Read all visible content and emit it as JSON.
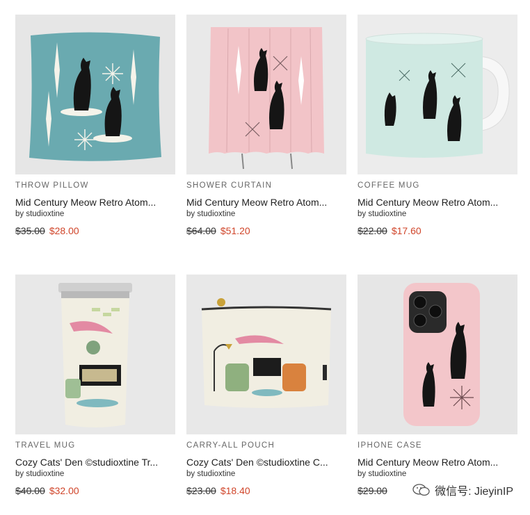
{
  "products": [
    {
      "category": "THROW PILLOW",
      "title": "Mid Century Meow Retro Atom...",
      "author": "by studioxtine",
      "old_price": "$35.00",
      "new_price": "$28.00"
    },
    {
      "category": "SHOWER CURTAIN",
      "title": "Mid Century Meow Retro Atom...",
      "author": "by studioxtine",
      "old_price": "$64.00",
      "new_price": "$51.20"
    },
    {
      "category": "COFFEE MUG",
      "title": "Mid Century Meow Retro Atom...",
      "author": "by studioxtine",
      "old_price": "$22.00",
      "new_price": "$17.60"
    },
    {
      "category": "TRAVEL MUG",
      "title": "Cozy Cats' Den ©studioxtine Tr...",
      "author": "by studioxtine",
      "old_price": "$40.00",
      "new_price": "$32.00"
    },
    {
      "category": "CARRY-ALL POUCH",
      "title": "Cozy Cats' Den ©studioxtine C...",
      "author": "by studioxtine",
      "old_price": "$23.00",
      "new_price": "$18.40"
    },
    {
      "category": "IPHONE CASE",
      "title": "Mid Century Meow Retro Atom...",
      "author": "by studioxtine",
      "old_price": "$29.00",
      "new_price": ""
    }
  ],
  "watermark": {
    "text": "微信号: JieyinIP",
    "icon": "wechat-icon"
  },
  "colors": {
    "sale_price": "#d0452a",
    "pillow_teal": "#6aaab0",
    "curtain_pink": "#f2c4c8",
    "mug_mint": "#cfe9e2",
    "retro_cream": "#f1eee2",
    "case_pink": "#f3c6ca"
  }
}
